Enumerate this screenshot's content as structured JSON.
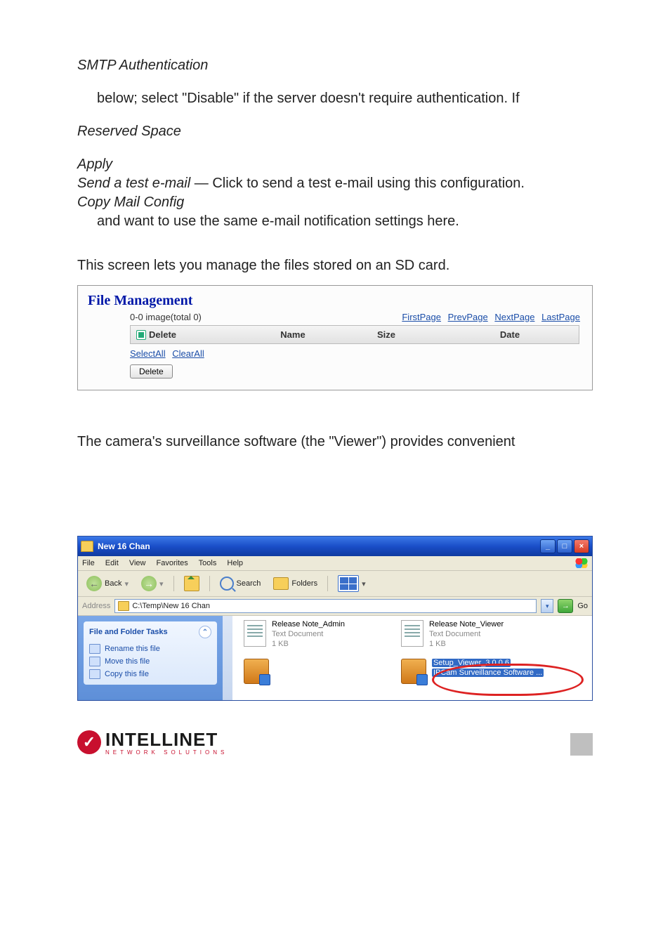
{
  "doc": {
    "h_smtp": "SMTP Authentication",
    "p_smtp": "below; select \"Disable\" if the server doesn't require authentication. If",
    "h_reserved": "Reserved Space",
    "h_apply": "Apply",
    "line_sendtest_label": "Send a test e-mail",
    "line_sendtest_rest": " — Click to send a test e-mail using this configuration.",
    "h_copymail": "Copy Mail Config",
    "p_copymail": "and want to use the same e-mail notification settings here.",
    "p_sd": "This screen lets you manage the files stored on an SD card.",
    "p_viewer": "The camera's surveillance software (the \"Viewer\") provides convenient"
  },
  "fm": {
    "title": "File Management",
    "count": "0-0 image(total 0)",
    "links": {
      "first": "FirstPage",
      "prev": "PrevPage",
      "next": "NextPage",
      "last": "LastPage"
    },
    "cols": {
      "delete": "Delete",
      "name": "Name",
      "size": "Size",
      "date": "Date"
    },
    "selectall": "SelectAll",
    "clearall": "ClearAll",
    "deleteBtn": "Delete"
  },
  "explorer": {
    "title": "New 16 Chan",
    "menus": [
      "File",
      "Edit",
      "View",
      "Favorites",
      "Tools",
      "Help"
    ],
    "toolbar": {
      "back": "Back",
      "search": "Search",
      "folders": "Folders"
    },
    "address_label": "Address",
    "address_value": "C:\\Temp\\New 16 Chan",
    "go": "Go",
    "taskpanel": {
      "header": "File and Folder Tasks",
      "items": [
        "Rename this file",
        "Move this file",
        "Copy this file"
      ]
    },
    "files": {
      "leftTop": {
        "name": "Release Note_Admin",
        "type": "Text Document",
        "size": "1 KB"
      },
      "rightTop": {
        "name": "Release Note_Viewer",
        "type": "Text Document",
        "size": "1 KB"
      },
      "rightBottom": {
        "name": "Setup_Viewer_3.0.0.6",
        "type": "IPCam Surveillance Software ..."
      }
    }
  },
  "logo": {
    "brand": "INTELLINET",
    "tag": "NETWORK SOLUTIONS"
  }
}
